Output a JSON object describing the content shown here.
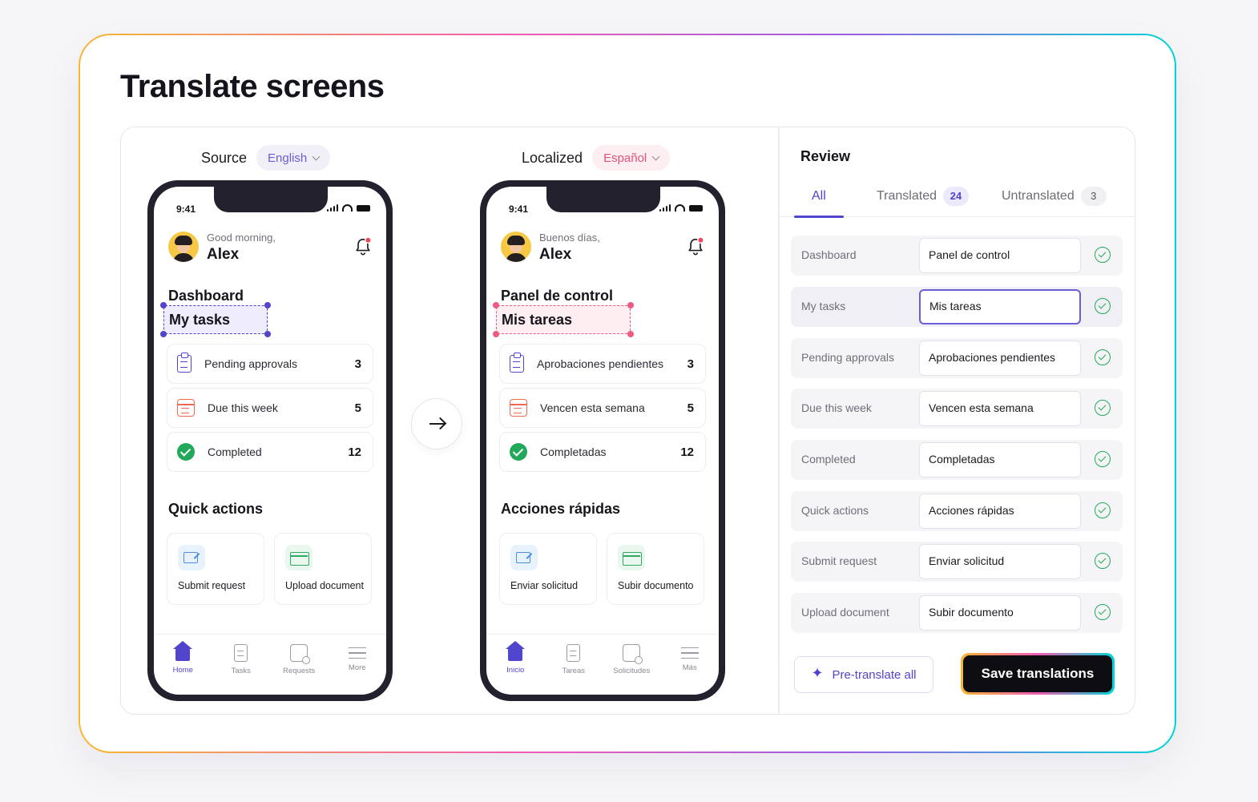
{
  "title": "Translate screens",
  "source": {
    "label": "Source",
    "language": "English"
  },
  "localized": {
    "label": "Localized",
    "language": "Español"
  },
  "phones": [
    {
      "time": "9:41",
      "greeting": "Good morning,",
      "name": "Alex",
      "dashboard": "Dashboard",
      "my_tasks": "My tasks",
      "stats": [
        {
          "label": "Pending approvals",
          "value": "3",
          "icon": "clipboard-icon"
        },
        {
          "label": "Due this week",
          "value": "5",
          "icon": "calendar-icon"
        },
        {
          "label": "Completed",
          "value": "12",
          "icon": "check-circle-icon"
        }
      ],
      "quick_actions_title": "Quick actions",
      "quick_actions": [
        "Submit request",
        "Upload document"
      ],
      "tabs": [
        "Home",
        "Tasks",
        "Requests",
        "More"
      ]
    },
    {
      "time": "9:41",
      "greeting": "Buenos días,",
      "name": "Alex",
      "dashboard": "Panel de control",
      "my_tasks": "Mis tareas",
      "stats": [
        {
          "label": "Aprobaciones pendientes",
          "value": "3",
          "icon": "clipboard-icon"
        },
        {
          "label": "Vencen esta semana",
          "value": "5",
          "icon": "calendar-icon"
        },
        {
          "label": "Completadas",
          "value": "12",
          "icon": "check-circle-icon"
        }
      ],
      "quick_actions_title": "Acciones rápidas",
      "quick_actions": [
        "Enviar solicitud",
        "Subir documento"
      ],
      "tabs": [
        "Inicio",
        "Tareas",
        "Solicitudes",
        "Más"
      ]
    }
  ],
  "review": {
    "title": "Review",
    "tabs": [
      {
        "label": "All",
        "count": ""
      },
      {
        "label": "Translated",
        "count": "24"
      },
      {
        "label": "Untranslated",
        "count": "3"
      }
    ],
    "rows": [
      {
        "source": "Dashboard",
        "translation": "Panel de control"
      },
      {
        "source": "My tasks",
        "translation": "Mis tareas"
      },
      {
        "source": "Pending approvals",
        "translation": "Aprobaciones pendientes"
      },
      {
        "source": "Due this week",
        "translation": "Vencen esta semana"
      },
      {
        "source": "Completed",
        "translation": "Completadas"
      },
      {
        "source": "Quick actions",
        "translation": "Acciones rápidas"
      },
      {
        "source": "Submit request",
        "translation": "Enviar solicitud"
      },
      {
        "source": "Upload document",
        "translation": "Subir documento"
      }
    ],
    "pretranslate_label": "Pre-translate all",
    "save_label": "Save translations"
  },
  "colors": {
    "accent": "#5145cd",
    "localized_accent": "#ee5a82",
    "success": "#22a85b",
    "dark": "#23212e"
  }
}
